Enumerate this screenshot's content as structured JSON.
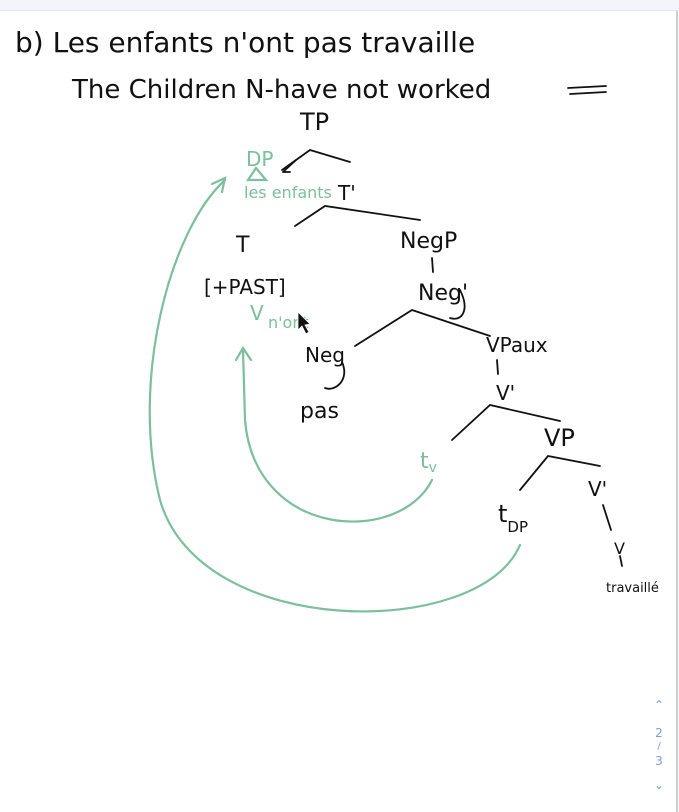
{
  "header": {
    "line1": "b) Les enfants n'ont pas travaille",
    "line2": "The Children N-have not worked"
  },
  "tree": {
    "tp": "TP",
    "dp": "DP",
    "dp_content": "les enfants",
    "t_bar": "T'",
    "t": "T",
    "t_feature": "[+PAST]",
    "v_moved": "V",
    "v_moved_word": "n'ont",
    "negp": "NegP",
    "neg_bar": "Neg'",
    "neg": "Neg",
    "pas": "pas",
    "vpaux": "VPaux",
    "v_bar_aux": "V'",
    "trace_v": "t",
    "trace_v_sub": "v",
    "vp": "VP",
    "trace_dp": "t",
    "trace_dp_sub": "DP",
    "v_bar": "V'",
    "v": "V",
    "verb": "travaillé"
  },
  "colors": {
    "ink": "#111111",
    "annotation": "#7cbf9c",
    "nav": "#7a9ed8"
  },
  "pager": {
    "current": "2",
    "separator": "/",
    "total": "3",
    "up_icon": "chevron-up-icon",
    "down_icon": "chevron-down-icon"
  }
}
